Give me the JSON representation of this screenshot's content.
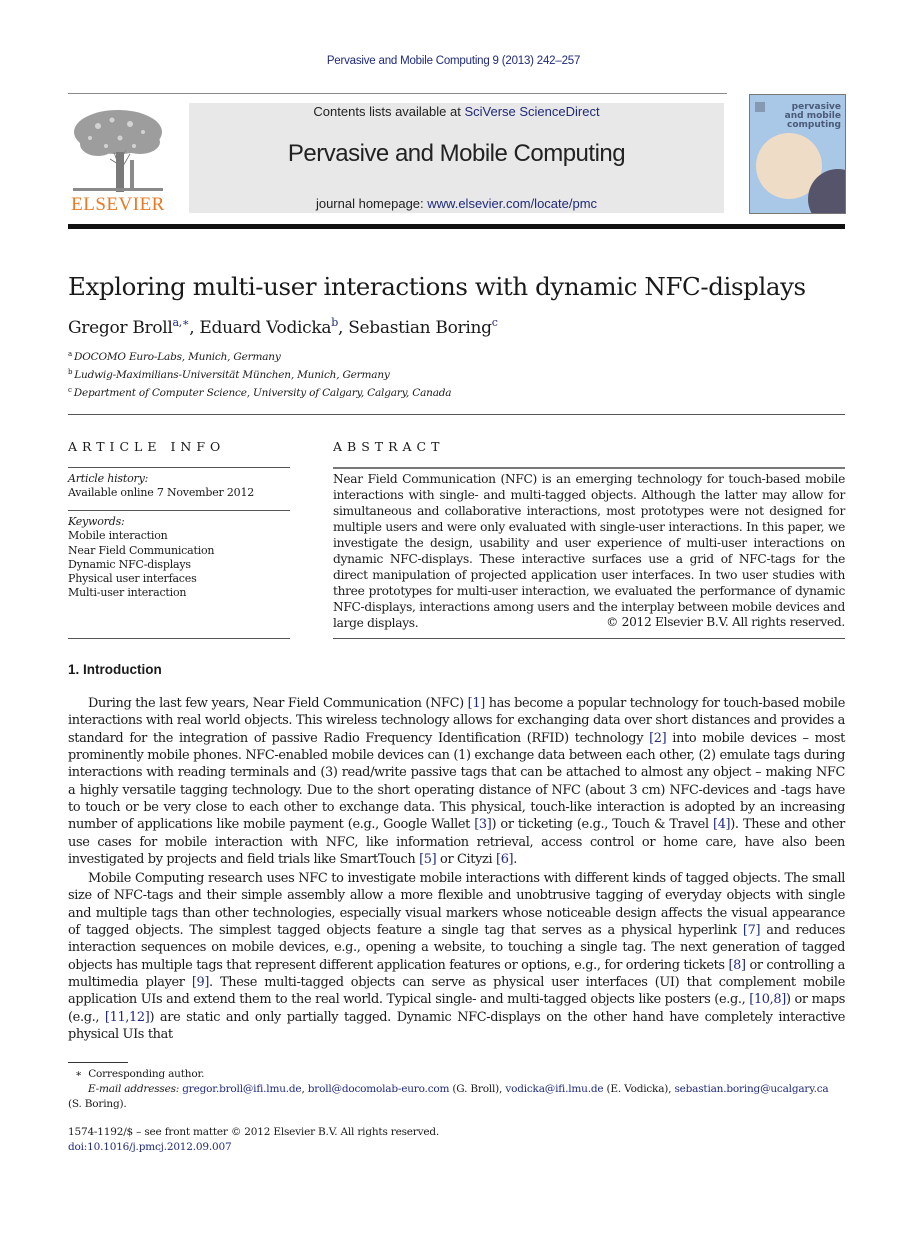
{
  "running_head": "Pervasive and Mobile Computing 9 (2013) 242–257",
  "masthead": {
    "publisher_logo_text": "ELSEVIER",
    "contents_prefix": "Contents lists available at ",
    "contents_link": "SciVerse ScienceDirect",
    "journal_name": "Pervasive and Mobile Computing",
    "homepage_prefix": "journal homepage: ",
    "homepage_link": "www.elsevier.com/locate/pmc",
    "cover_title_lines": [
      "pervasive",
      "and mobile",
      "computing"
    ],
    "colors": {
      "publisher_orange": "#e87a24",
      "link_blue": "#1f2a7a",
      "cover_blue": "#a9c7e6"
    }
  },
  "article": {
    "title": "Exploring multi-user interactions with dynamic NFC-displays",
    "authors": [
      {
        "name": "Gregor Broll",
        "marks": "a,∗"
      },
      {
        "name": "Eduard Vodicka",
        "marks": "b"
      },
      {
        "name": "Sebastian Boring",
        "marks": "c"
      }
    ],
    "affiliations": [
      {
        "mark": "a",
        "text": "DOCOMO Euro-Labs, Munich, Germany"
      },
      {
        "mark": "b",
        "text": "Ludwig-Maximilians-Universität München, Munich, Germany"
      },
      {
        "mark": "c",
        "text": "Department of Computer Science, University of Calgary, Calgary, Canada"
      }
    ]
  },
  "article_info": {
    "heading": "ARTICLE INFO",
    "history_label": "Article history:",
    "history_value": "Available online 7 November 2012",
    "keywords_label": "Keywords:",
    "keywords": [
      "Mobile interaction",
      "Near Field Communication",
      "Dynamic NFC-displays",
      "Physical user interfaces",
      "Multi-user interaction"
    ]
  },
  "abstract": {
    "heading": "ABSTRACT",
    "text": "Near Field Communication (NFC) is an emerging technology for touch-based mobile interactions with single- and multi-tagged objects. Although the latter may allow for simultaneous and collaborative interactions, most prototypes were not designed for multiple users and were only evaluated with single-user interactions. In this paper, we investigate the design, usability and user experience of multi-user interactions on dynamic NFC-displays. These interactive surfaces use a grid of NFC-tags for the direct manipulation of projected application user interfaces. In two user studies with three prototypes for multi-user interaction, we evaluated the performance of dynamic NFC-displays, interactions among users and the interplay between mobile devices and large displays.",
    "copyright": "© 2012 Elsevier B.V. All rights reserved."
  },
  "introduction": {
    "heading": "1.  Introduction",
    "paragraphs": [
      [
        {
          "t": "During the last few years, Near Field Communication (NFC) "
        },
        {
          "ref": "[1]"
        },
        {
          "t": " has become a popular technology for touch-based mobile interactions with real world objects. This wireless technology allows for exchanging data over short distances and provides a standard for the integration of passive Radio Frequency Identification (RFID) technology "
        },
        {
          "ref": "[2]"
        },
        {
          "t": " into mobile devices – most prominently mobile phones. NFC-enabled mobile devices can (1) exchange data between each other, (2) emulate tags during interactions with reading terminals and (3) read/write passive tags that can be attached to almost any object – making NFC a highly versatile tagging technology. Due to the short operating distance of NFC (about 3 cm) NFC-devices and -tags have to touch or be very close to each other to exchange data. This physical, touch-like interaction is adopted by an increasing number of applications like mobile payment (e.g., Google Wallet "
        },
        {
          "ref": "[3]"
        },
        {
          "t": ") or ticketing (e.g., Touch & Travel "
        },
        {
          "ref": "[4]"
        },
        {
          "t": "). These and other use cases for mobile interaction with NFC, like information retrieval, access control or home care, have also been investigated by projects and field trials like SmartTouch "
        },
        {
          "ref": "[5]"
        },
        {
          "t": " or Cityzi "
        },
        {
          "ref": "[6]"
        },
        {
          "t": "."
        }
      ],
      [
        {
          "t": "Mobile Computing research uses NFC to investigate mobile interactions with different kinds of tagged objects. The small size of NFC-tags and their simple assembly allow a more flexible and unobtrusive tagging of everyday objects with single and multiple tags than other technologies, especially visual markers whose noticeable design affects the visual appearance of tagged objects. The simplest tagged objects feature a single tag that serves as a physical hyperlink "
        },
        {
          "ref": "[7]"
        },
        {
          "t": " and reduces interaction sequences on mobile devices, e.g., opening a website, to touching a single tag. The next generation of tagged objects has multiple tags that represent different application features or options, e.g., for ordering tickets "
        },
        {
          "ref": "[8]"
        },
        {
          "t": " or controlling a multimedia player "
        },
        {
          "ref": "[9]"
        },
        {
          "t": ". These multi-tagged objects can serve as physical user interfaces (UI) that complement mobile application UIs and extend them to the real world. Typical single- and multi-tagged objects like posters (e.g., "
        },
        {
          "ref": "[10,8]"
        },
        {
          "t": ") or maps (e.g., "
        },
        {
          "ref": "[11,12]"
        },
        {
          "t": ") are static and only partially tagged. Dynamic NFC-displays on the other hand have completely interactive physical UIs that"
        }
      ]
    ]
  },
  "footnotes": {
    "corresponding_mark": "∗",
    "corresponding_text": "Corresponding author.",
    "email_label": "E-mail addresses:",
    "emails": [
      {
        "address": "gregor.broll@ifi.lmu.de",
        "after": ", "
      },
      {
        "address": "broll@docomolab-euro.com",
        "after": " (G. Broll), "
      },
      {
        "address": "vodicka@ifi.lmu.de",
        "after": " (E. Vodicka), "
      },
      {
        "address": "sebastian.boring@ucalgary.ca",
        "after": " (S. Boring)."
      }
    ],
    "front_matter": "1574-1192/$ – see front matter © 2012 Elsevier B.V. All rights reserved.",
    "doi": "doi:10.1016/j.pmcj.2012.09.007"
  }
}
